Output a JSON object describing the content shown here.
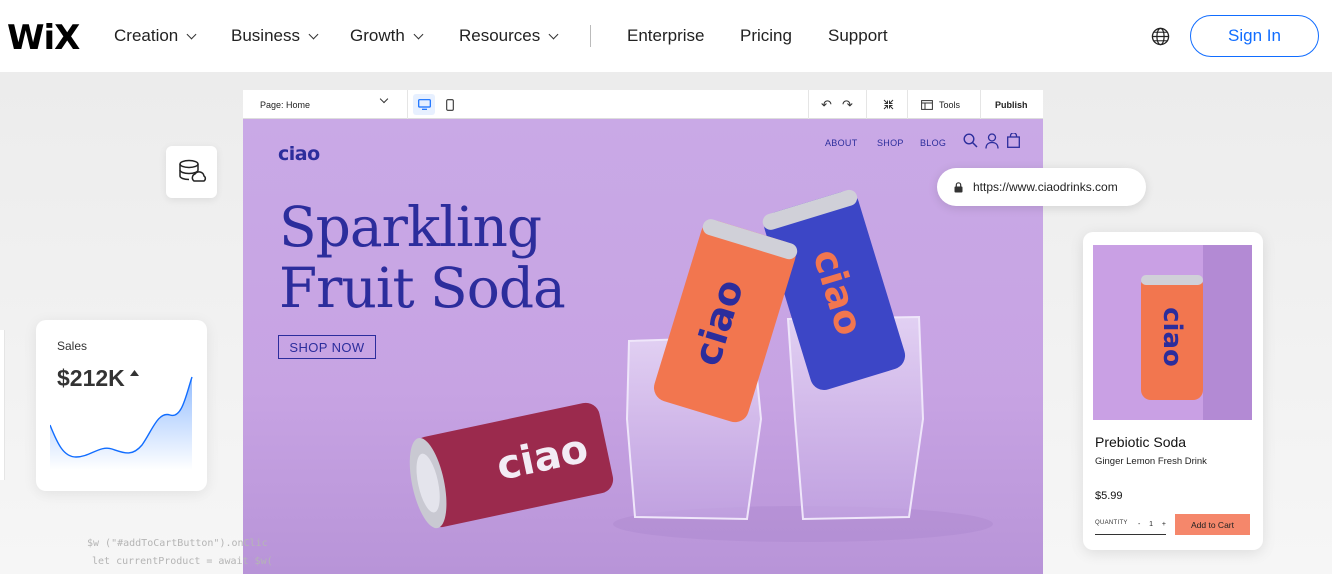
{
  "brand": {
    "logo": "WiX"
  },
  "nav": {
    "items": [
      {
        "label": "Creation",
        "dropdown": true
      },
      {
        "label": "Business",
        "dropdown": true
      },
      {
        "label": "Growth",
        "dropdown": true
      },
      {
        "label": "Resources",
        "dropdown": true
      },
      {
        "label": "Enterprise",
        "dropdown": false
      },
      {
        "label": "Pricing",
        "dropdown": false
      },
      {
        "label": "Support",
        "dropdown": false
      }
    ],
    "language_icon": "globe-icon",
    "sign_in": "Sign In"
  },
  "editor": {
    "page_select": "Page: Home",
    "tools_label": "Tools",
    "publish_label": "Publish"
  },
  "site": {
    "logo": "ciao",
    "nav": [
      "ABOUT",
      "SHOP",
      "BLOG"
    ],
    "headline_line1": "Sparkling",
    "headline_line2": "Fruit Soda",
    "cta": "SHOP NOW",
    "can_text": "ciao"
  },
  "url_bar": {
    "url": "https://www.ciaodrinks.com"
  },
  "sales": {
    "label": "Sales",
    "value": "$212K"
  },
  "product": {
    "name": "Prebiotic Soda",
    "subtitle": "Ginger Lemon Fresh Drink",
    "price": "$5.99",
    "quantity_label": "QUANTITY",
    "quantity": "1",
    "add_to_cart": "Add to Cart",
    "can_text": "ciao"
  },
  "code": {
    "line1": "$w (\"#addToCartButton\").onClic",
    "line2": "let currentProduct = await $w("
  },
  "colors": {
    "accent": "#116dff",
    "site_brand": "#2c2d9c",
    "site_bg": "#c9a9e6",
    "cart_button": "#f5876b"
  }
}
